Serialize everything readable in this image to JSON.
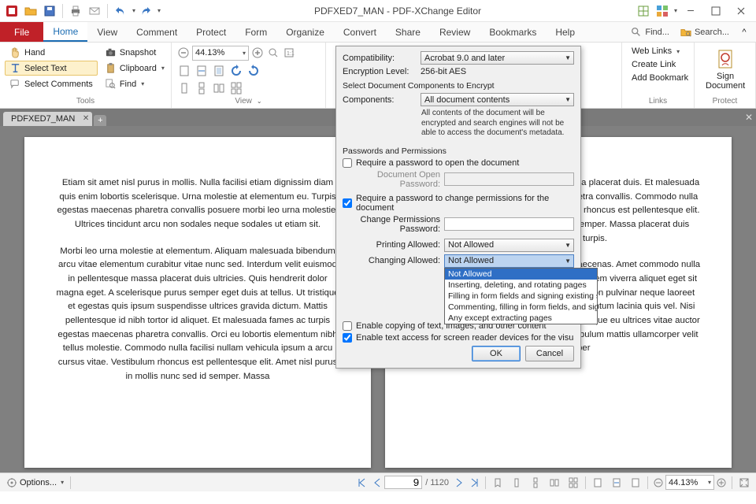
{
  "window": {
    "title": "PDFXED7_MAN - PDF-XChange Editor"
  },
  "menubar": {
    "file": "File",
    "items": [
      "Home",
      "View",
      "Comment",
      "Protect",
      "Form",
      "Organize",
      "Convert",
      "Share",
      "Review",
      "Bookmarks",
      "Help"
    ],
    "find": "Find...",
    "search": "Search..."
  },
  "ribbon": {
    "tools": {
      "hand": "Hand",
      "select_text": "Select Text",
      "select_comments": "Select Comments",
      "snapshot": "Snapshot",
      "clipboard": "Clipboard",
      "find": "Find",
      "footer": "Tools"
    },
    "view": {
      "zoom": "44.13%",
      "footer": "View"
    },
    "links": {
      "weblinks": "Web Links",
      "create": "Create Link",
      "addbm": "Add Bookmark",
      "footer": "Links"
    },
    "protect": {
      "sign": "Sign\nDocument",
      "footer": "Protect"
    }
  },
  "tab": {
    "name": "PDFXED7_MAN"
  },
  "dialog": {
    "compat_label": "Compatibility:",
    "compat_value": "Acrobat 9.0 and later",
    "enc_label": "Encryption Level:",
    "enc_value": "256-bit AES",
    "sec_components": "Select Document Components to Encrypt",
    "components_label": "Components:",
    "components_value": "All document contents",
    "components_note": "All contents of the document will be encrypted and search engines will not be able to access the document's metadata.",
    "sec_pw": "Passwords and Permissions",
    "req_open": "Require a password to open the document",
    "open_pw_label": "Document Open Password:",
    "req_change": "Require a password to change permissions for the document",
    "change_pw_label": "Change Permissions Password:",
    "printing_label": "Printing Allowed:",
    "printing_value": "Not Allowed",
    "changing_label": "Changing Allowed:",
    "changing_value": "Not Allowed",
    "changing_options": [
      "Not Allowed",
      "Inserting, deleting, and rotating pages",
      "Filling in form fields and signing existing signature fields",
      "Commenting, filling in form fields, and signing existing signature fields",
      "Any except extracting pages"
    ],
    "enable_copy": "Enable copying of text, images, and other content",
    "enable_access": "Enable text access for screen reader devices for the visually impaired",
    "ok": "OK",
    "cancel": "Cancel"
  },
  "doc": {
    "p1a": "Etiam sit amet nisl purus in mollis. Nulla facilisi etiam dignissim diam quis enim lobortis scelerisque. Urna molestie at elementum eu. Turpis egestas maecenas pharetra convallis posuere morbi leo urna molestie. Ultrices tincidunt arcu non sodales neque sodales ut etiam sit.",
    "p1b": "Morbi leo urna molestie at elementum. Aliquam malesuada bibendum arcu vitae elementum curabitur vitae nunc sed. Interdum velit euismod in pellentesque massa placerat duis ultricies. Quis hendrerit dolor magna eget. A scelerisque purus semper eget duis at tellus. Ut tristique et egestas quis ipsum suspendisse ultrices gravida dictum. Mattis pellentesque id nibh tortor id aliquet. Et malesuada fames ac turpis egestas maecenas pharetra convallis. Orci eu lobortis elementum nibh tellus molestie. Commodo nulla facilisi nullam vehicula ipsum a arcu cursus vitae. Vestibulum rhoncus est pellentesque elit. Amet nisl purus in mollis nunc sed id semper. Massa",
    "p2a": "purus in mollis nunc sed id semper. Massa placerat duis. Et malesuada fames ac turpis egestas maecenas pharetra convallis. Commodo nulla facilisi nullam vehicula ipsum. Vestibulum rhoncus est pellentesque elit. Amet nisl purus in mollis nunc sed id semper. Massa placerat duis ultricies lacus sed turpis.",
    "p2b": "Nisi vitae suscipit tellus mauris a diam maecenas. Amet commodo nulla facilisi nullam vehicula ipsum. Sed enim ut sem viverra aliquet eget sit amet. Magna eget est lorem ipsum dolor. Non pulvinar neque laoreet suspendisse interdum. Vitae tortor condimentum lacinia quis vel. Nisi quis eleifend quam adipiscing vitae. Scelerisque eu ultrices vitae auctor eu augue ut lectus arcu. Sed lectus vestibulum mattis ullamcorper velit sed ullamcorper"
  },
  "status": {
    "options": "Options...",
    "page": "9",
    "pages": "1120",
    "zoom": "44.13%"
  }
}
